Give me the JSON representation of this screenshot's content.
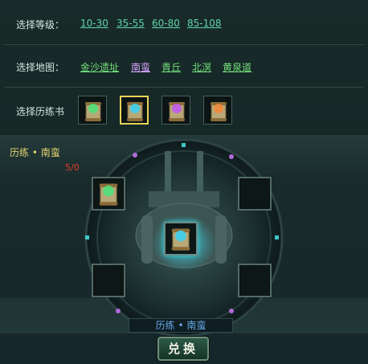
{
  "level_row": {
    "label": "选择等级：",
    "options": [
      "10-30",
      "35-55",
      "60-80",
      "85-108"
    ]
  },
  "map_row": {
    "label": "选择地图：",
    "options": [
      "金沙遗址",
      "南蛮",
      "青丘",
      "北溟",
      "黄泉道"
    ],
    "selected_index": 1
  },
  "book_row": {
    "label": "选择历练书",
    "books": [
      "green-scroll-icon",
      "blue-scroll-icon",
      "purple-scroll-icon",
      "orange-scroll-icon"
    ],
    "selected_index": 1
  },
  "synthesis": {
    "title": "历练 • 南蛮",
    "count": "5/0",
    "result_label": "历练 • 南蛮",
    "exchange_label": "兑换"
  },
  "colors": {
    "level_link": "#5fd6a8",
    "map_link": "#73e07d",
    "map_selected": "#d6a6ff",
    "title": "#e4d46e",
    "count": "#e23b2b",
    "result": "#66a7e6"
  }
}
